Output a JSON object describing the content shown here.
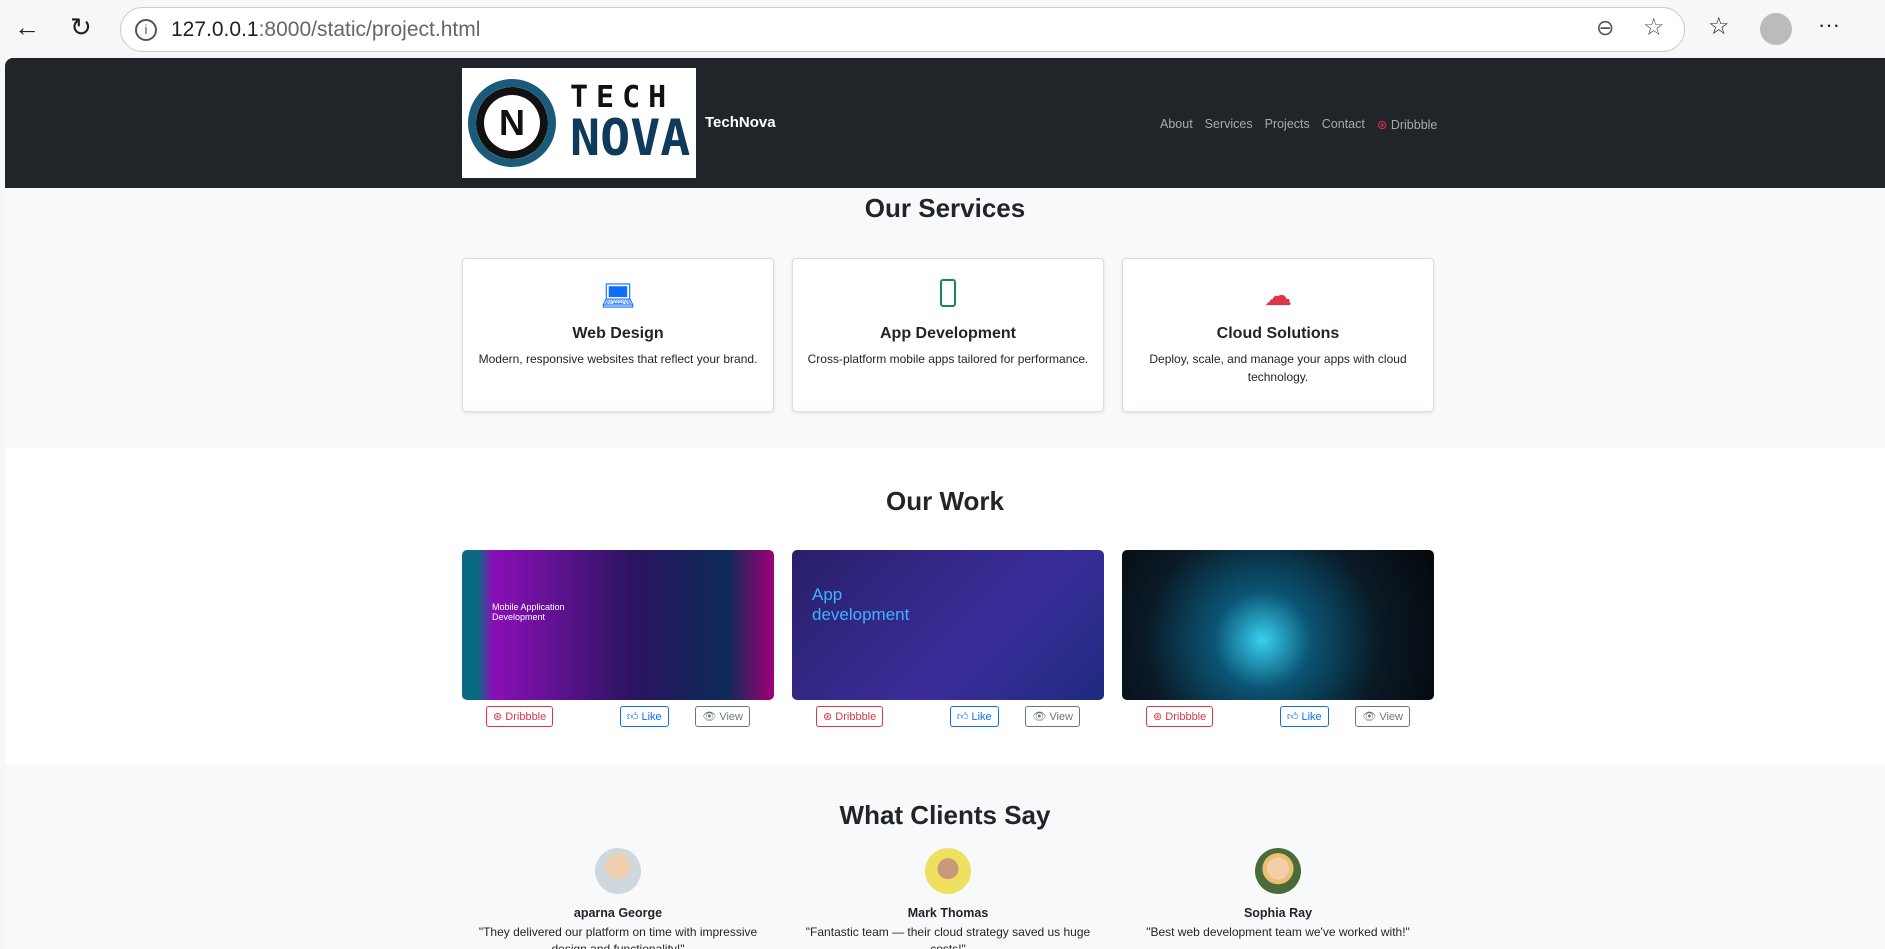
{
  "browser": {
    "url_host": "127.0.0.1",
    "url_rest": ":8000/static/project.html"
  },
  "nav": {
    "brand": "TechNova",
    "logo_text_top": "TECH",
    "logo_text_bottom": "NOVA",
    "links": [
      "About",
      "Services",
      "Projects",
      "Contact"
    ],
    "dribbble": "Dribbble"
  },
  "services": {
    "title": "Our Services",
    "items": [
      {
        "title": "Web Design",
        "desc": "Modern, responsive websites that reflect your brand.",
        "icon": "laptop-icon",
        "color": "#0d6efd"
      },
      {
        "title": "App Development",
        "desc": "Cross-platform mobile apps tailored for performance.",
        "icon": "phone-icon",
        "color": "#198754"
      },
      {
        "title": "Cloud Solutions",
        "desc": "Deploy, scale, and manage your apps with cloud technology.",
        "icon": "cloud-upload-icon",
        "color": "#dc3545"
      }
    ]
  },
  "work": {
    "title": "Our Work",
    "projects": [
      {
        "caption": "Mobile Application Development"
      },
      {
        "caption": "App development"
      },
      {
        "caption": ""
      }
    ],
    "buttons": {
      "dribbble": "Dribbble",
      "like": "Like",
      "view": "View"
    }
  },
  "clients": {
    "title": "What Clients Say",
    "items": [
      {
        "name": "aparna George",
        "quote": "\"They delivered our platform on time with impressive design and functionality!\""
      },
      {
        "name": "Mark Thomas",
        "quote": "\"Fantastic team — their cloud strategy saved us huge costs!\""
      },
      {
        "name": "Sophia Ray",
        "quote": "\"Best web development team we've worked with!\""
      }
    ]
  }
}
